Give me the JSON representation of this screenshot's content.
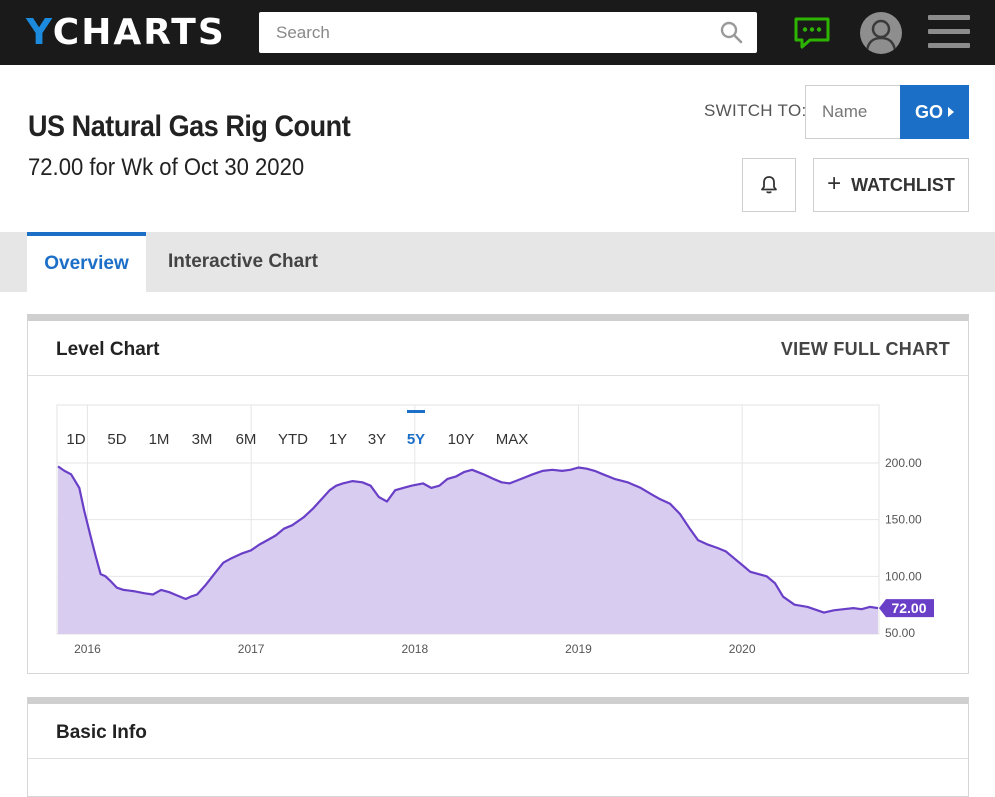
{
  "nav": {
    "logo_y": "Y",
    "logo_rest": "CHARTS",
    "search_placeholder": "Search"
  },
  "header": {
    "title": "US Natural Gas Rig Count",
    "subtitle": "72.00 for Wk of Oct 30 2020",
    "switch_label": "SWITCH TO:",
    "switch_placeholder": "Name",
    "go_label": "GO",
    "watchlist_label": "WATCHLIST"
  },
  "tabs": [
    {
      "label": "Overview",
      "active": true
    },
    {
      "label": "Interactive Chart",
      "active": false
    }
  ],
  "level_chart_card": {
    "title": "Level Chart",
    "link": "VIEW FULL CHART",
    "ranges": [
      "1D",
      "5D",
      "1M",
      "3M",
      "6M",
      "YTD",
      "1Y",
      "3Y",
      "5Y",
      "10Y",
      "MAX"
    ],
    "active_range": "5Y"
  },
  "basic_info_card": {
    "title": "Basic Info"
  },
  "colors": {
    "brand_blue": "#1b6fc7",
    "logo_blue": "#1c8bde",
    "line": "#6a3fc8",
    "fill": "#d9ccf1",
    "chat_green": "#2db400"
  },
  "chart_data": {
    "type": "area",
    "x_ticks": [
      "2016",
      "2017",
      "2018",
      "2019",
      "2020"
    ],
    "y_ticks": [
      "200.00",
      "150.00",
      "100.00",
      "50.00"
    ],
    "ylim": [
      50,
      200
    ],
    "xlim": [
      2015.82,
      2020.83
    ],
    "last_value_label": "72.00",
    "x": [
      2015.82,
      2015.86,
      2015.9,
      2015.95,
      2015.98,
      2016.02,
      2016.05,
      2016.08,
      2016.11,
      2016.14,
      2016.18,
      2016.22,
      2016.28,
      2016.35,
      2016.4,
      2016.45,
      2016.5,
      2016.55,
      2016.6,
      2016.63,
      2016.67,
      2016.72,
      2016.78,
      2016.83,
      2016.88,
      2016.94,
      2017.0,
      2017.05,
      2017.1,
      2017.15,
      2017.2,
      2017.25,
      2017.32,
      2017.38,
      2017.43,
      2017.48,
      2017.52,
      2017.56,
      2017.62,
      2017.68,
      2017.73,
      2017.78,
      2017.83,
      2017.88,
      2017.93,
      2017.98,
      2018.05,
      2018.1,
      2018.15,
      2018.2,
      2018.25,
      2018.3,
      2018.35,
      2018.42,
      2018.48,
      2018.53,
      2018.58,
      2018.65,
      2018.72,
      2018.78,
      2018.84,
      2018.9,
      2018.95,
      2019.0,
      2019.05,
      2019.1,
      2019.15,
      2019.22,
      2019.3,
      2019.38,
      2019.45,
      2019.5,
      2019.56,
      2019.62,
      2019.68,
      2019.73,
      2019.79,
      2019.85,
      2019.9,
      2019.95,
      2020.0,
      2020.05,
      2020.1,
      2020.15,
      2020.2,
      2020.25,
      2020.32,
      2020.4,
      2020.46,
      2020.5,
      2020.56,
      2020.62,
      2020.68,
      2020.73,
      2020.78,
      2020.83
    ],
    "y": [
      197,
      193,
      190,
      178,
      158,
      135,
      118,
      102,
      100,
      96,
      90,
      88,
      87,
      85,
      84,
      88,
      86,
      83,
      80,
      82,
      84,
      92,
      103,
      112,
      116,
      120,
      123,
      128,
      132,
      136,
      142,
      145,
      152,
      160,
      168,
      176,
      180,
      182,
      184,
      183,
      180,
      170,
      166,
      176,
      178,
      180,
      182,
      178,
      180,
      186,
      188,
      192,
      194,
      190,
      186,
      183,
      182,
      186,
      190,
      193,
      194,
      193,
      194,
      196,
      195,
      193,
      190,
      186,
      183,
      178,
      172,
      168,
      164,
      155,
      142,
      132,
      128,
      125,
      122,
      116,
      110,
      104,
      102,
      100,
      94,
      82,
      75,
      73,
      70,
      68,
      70,
      71,
      72,
      71,
      73,
      72
    ]
  }
}
